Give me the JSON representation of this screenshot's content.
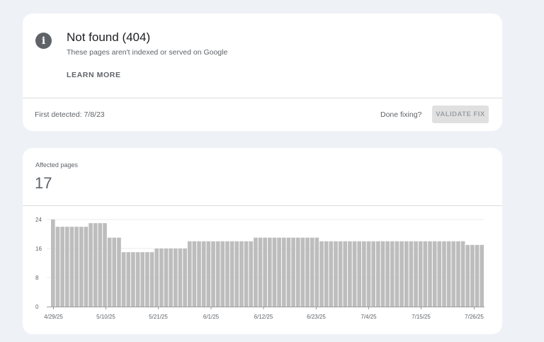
{
  "issue": {
    "icon": "info-icon",
    "title": "Not found (404)",
    "subtitle": "These pages aren't indexed or served on Google",
    "learn_more": "LEARN MORE",
    "first_detected": "First detected: 7/8/23",
    "done_fixing": "Done fixing?",
    "validate_fix": "VALIDATE FIX"
  },
  "metric": {
    "label": "Affected pages",
    "value": "17"
  },
  "colors": {
    "bar": "#bdbdbd",
    "axis": "#9e9e9e",
    "gridline": "#eeeeee",
    "tick_text": "#5f6368"
  },
  "chart_data": {
    "type": "bar",
    "ylim": [
      0,
      24
    ],
    "yticks": [
      0,
      8,
      16,
      24
    ],
    "x_start": "4/29/25",
    "xtick_labels": [
      "4/29/25",
      "5/10/25",
      "5/21/25",
      "6/1/25",
      "6/12/25",
      "6/23/25",
      "7/4/25",
      "7/15/25",
      "7/26/25"
    ],
    "values": [
      24,
      22,
      22,
      22,
      22,
      22,
      22,
      22,
      23,
      23,
      23,
      23,
      19,
      19,
      19,
      15,
      15,
      15,
      15,
      15,
      15,
      15,
      16,
      16,
      16,
      16,
      16,
      16,
      16,
      18,
      18,
      18,
      18,
      18,
      18,
      18,
      18,
      18,
      18,
      18,
      18,
      18,
      18,
      19,
      19,
      19,
      19,
      19,
      19,
      19,
      19,
      19,
      19,
      19,
      19,
      19,
      19,
      18,
      18,
      18,
      18,
      18,
      18,
      18,
      18,
      18,
      18,
      18,
      18,
      18,
      18,
      18,
      18,
      18,
      18,
      18,
      18,
      18,
      18,
      18,
      18,
      18,
      18,
      18,
      18,
      18,
      18,
      18,
      17,
      17,
      17,
      17
    ]
  }
}
